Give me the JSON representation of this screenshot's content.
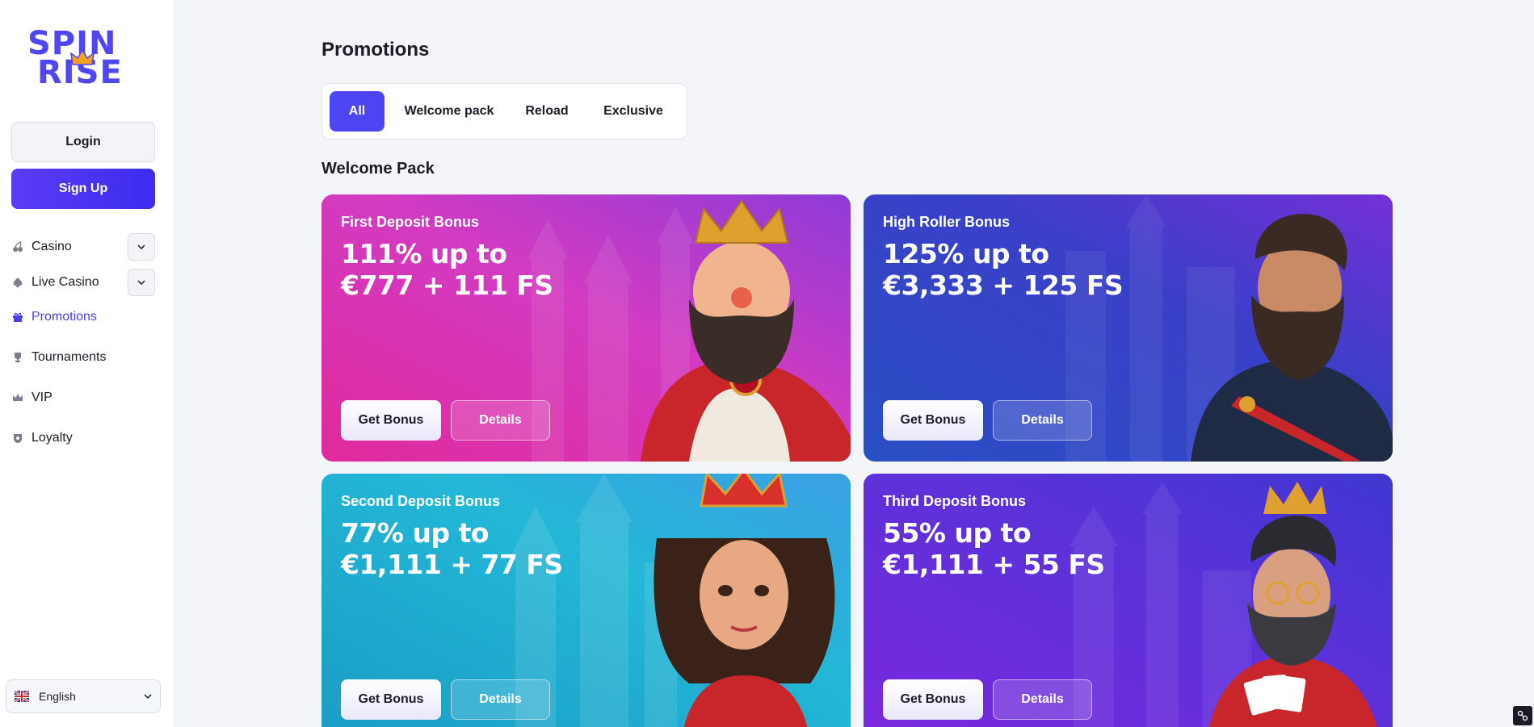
{
  "brand": {
    "line1": "SPIN",
    "line2": "RISE",
    "color": "#5146f3",
    "accent": "#f4a21c"
  },
  "auth": {
    "login_label": "Login",
    "signup_label": "Sign Up"
  },
  "sidebar": {
    "items": [
      {
        "label": "Casino",
        "icon": "cherries-icon",
        "expandable": true,
        "active": false
      },
      {
        "label": "Live Casino",
        "icon": "spade-icon",
        "expandable": true,
        "active": false
      },
      {
        "label": "Promotions",
        "icon": "gift-icon",
        "expandable": false,
        "active": true
      },
      {
        "label": "Tournaments",
        "icon": "trophy-icon",
        "expandable": false,
        "active": false
      },
      {
        "label": "VIP",
        "icon": "crown-icon",
        "expandable": false,
        "active": false
      },
      {
        "label": "Loyalty",
        "icon": "badge-icon",
        "expandable": false,
        "active": false
      }
    ],
    "language": {
      "label": "English",
      "icon": "uk-flag-icon"
    }
  },
  "main": {
    "title": "Promotions",
    "tabs": [
      {
        "label": "All",
        "active": true
      },
      {
        "label": "Welcome pack",
        "active": false
      },
      {
        "label": "Reload",
        "active": false
      },
      {
        "label": "Exclusive",
        "active": false
      }
    ],
    "section_title": "Welcome Pack",
    "cards": [
      {
        "title": "First Deposit Bonus",
        "line1": "111% up to",
        "line2": "€777 + 111 FS",
        "get_label": "Get Bonus",
        "details_label": "Details",
        "colors": [
          "#e23aa8",
          "#9a34c9"
        ]
      },
      {
        "title": "High Roller Bonus",
        "line1": "125% up to",
        "line2": "€3,333 + 125 FS",
        "get_label": "Get Bonus",
        "details_label": "Details",
        "colors": [
          "#2f51c6",
          "#6b2fd4"
        ]
      },
      {
        "title": "Second Deposit Bonus",
        "line1": "77% up to",
        "line2": "€1,111 + 77 FS",
        "get_label": "Get Bonus",
        "details_label": "Details",
        "colors": [
          "#1ba3c8",
          "#3aa7e0"
        ]
      },
      {
        "title": "Third Deposit Bonus",
        "line1": "55% up to",
        "line2": "€1,111 + 55 FS",
        "get_label": "Get Bonus",
        "details_label": "Details",
        "colors": [
          "#7a2ee0",
          "#4630d6"
        ]
      }
    ]
  }
}
